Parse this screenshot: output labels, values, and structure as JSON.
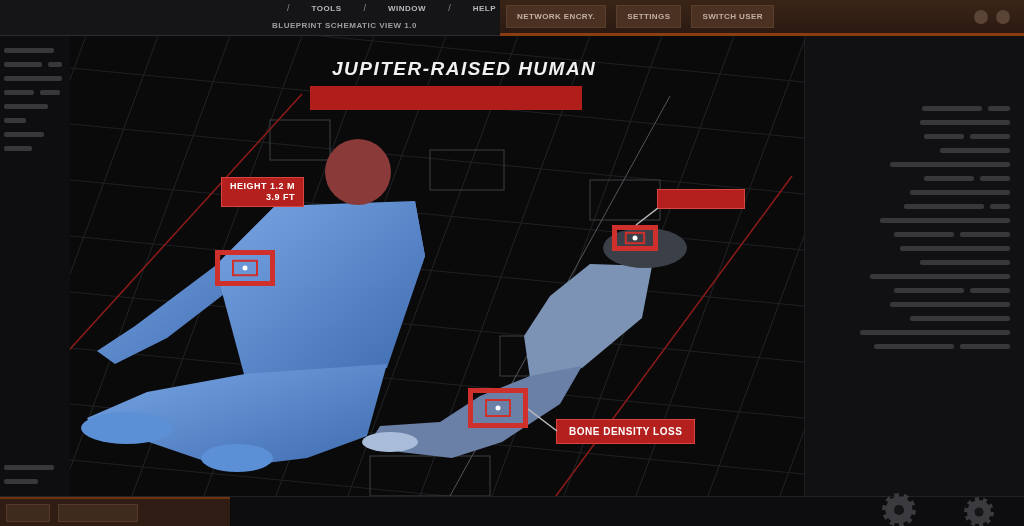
{
  "menu_bar": {
    "entries": [
      {
        "kind": "separator",
        "label": "/"
      },
      {
        "kind": "item",
        "label": "TOOLS"
      },
      {
        "kind": "separator",
        "label": "/"
      },
      {
        "kind": "item",
        "label": "WINDOW"
      },
      {
        "kind": "separator",
        "label": "/"
      },
      {
        "kind": "item",
        "label": "HELP"
      }
    ],
    "subtitle": "BLUEPRINT SCHEMATIC VIEW 1.0"
  },
  "header_buttons": [
    "NETWORK ENCRY.",
    "SETTINGS",
    "SWITCH USER"
  ],
  "schematic": {
    "title": "JUPITER-RAISED HUMAN",
    "height_tag": {
      "lines": [
        "HEIGHT 1.2 M",
        "3.9 FT"
      ]
    },
    "callout": "BONE DENSITY LOSS"
  }
}
